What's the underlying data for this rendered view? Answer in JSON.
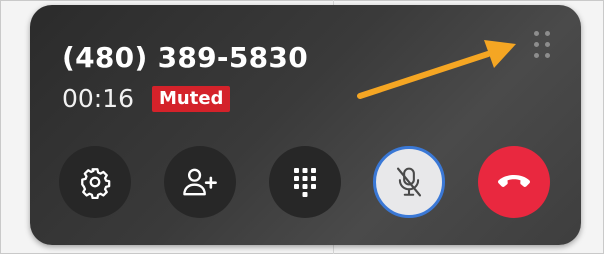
{
  "call": {
    "phone_number": "(480) 389-5830",
    "timer": "00:16",
    "status_badge": "Muted"
  },
  "controls": {
    "settings": "gear-icon",
    "add_participant": "add-person-icon",
    "keypad": "dialpad-icon",
    "mute": "microphone-muted-icon",
    "end_call": "hang-up-icon"
  },
  "colors": {
    "badge": "#d4222a",
    "end_call": "#e9283f",
    "mute_ring": "#3a78d6",
    "annotation_arrow": "#f5a623"
  }
}
